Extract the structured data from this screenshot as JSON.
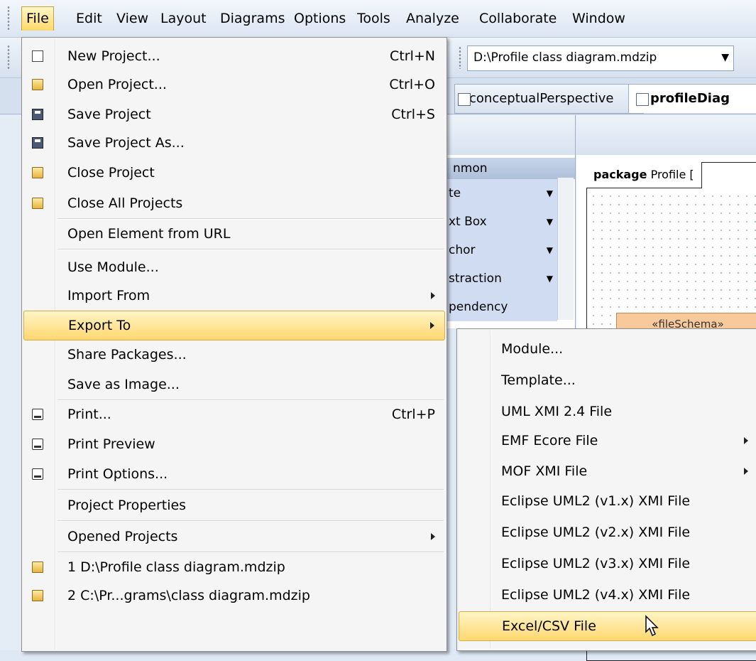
{
  "menubar": {
    "items": [
      "File",
      "Edit",
      "View",
      "Layout",
      "Diagrams",
      "Options",
      "Tools",
      "Analyze",
      "Collaborate",
      "Window"
    ]
  },
  "toolbar": {
    "project_combo": "D:\\Profile class diagram.mdzip"
  },
  "tabs": {
    "tab1": "conceptualPerspective",
    "tab2": "profileDiag"
  },
  "palette": {
    "header": "nmon",
    "rows": [
      "te",
      "xt Box",
      "chor",
      "straction",
      "pendency"
    ]
  },
  "diagram": {
    "package_label": "package  Profile [",
    "schema": "«fileSchema»"
  },
  "file_menu": {
    "items": [
      {
        "label": "New Project...",
        "shortcut": "Ctrl+N",
        "icon": "new-document-icon"
      },
      {
        "label": "Open Project...",
        "shortcut": "Ctrl+O",
        "icon": "open-folder-icon"
      },
      {
        "label": "Save Project",
        "shortcut": "Ctrl+S",
        "icon": "save-icon"
      },
      {
        "label": "Save Project As...",
        "shortcut": "",
        "icon": "save-as-icon"
      },
      {
        "label": "Close Project",
        "shortcut": "",
        "icon": "close-folder-icon"
      },
      {
        "label": "Close All Projects",
        "shortcut": "",
        "icon": "close-all-folders-icon"
      },
      {
        "label": "Open Element from URL",
        "shortcut": ""
      },
      {
        "label": "Use Module...",
        "shortcut": ""
      },
      {
        "label": "Import From",
        "shortcut": "",
        "submenu": true
      },
      {
        "label": "Export To",
        "shortcut": "",
        "submenu": true,
        "highlighted": true
      },
      {
        "label": "Share Packages...",
        "shortcut": ""
      },
      {
        "label": "Save as Image...",
        "shortcut": ""
      },
      {
        "label": "Print...",
        "shortcut": "Ctrl+P",
        "icon": "print-icon"
      },
      {
        "label": "Print Preview",
        "shortcut": "",
        "icon": "print-preview-icon"
      },
      {
        "label": "Print Options...",
        "shortcut": "",
        "icon": "print-options-icon"
      },
      {
        "label": "Project Properties",
        "shortcut": ""
      },
      {
        "label": "Opened Projects",
        "shortcut": "",
        "submenu": true
      },
      {
        "label": "1 D:\\Profile class diagram.mdzip",
        "shortcut": "",
        "icon": "recent-project-icon"
      },
      {
        "label": "2 C:\\Pr...grams\\class diagram.mdzip",
        "shortcut": "",
        "icon": "recent-project-icon"
      }
    ]
  },
  "export_menu": {
    "items": [
      {
        "label": "Module..."
      },
      {
        "label": "Template..."
      },
      {
        "label": "UML XMI 2.4 File"
      },
      {
        "label": "EMF Ecore File",
        "submenu": true
      },
      {
        "label": "MOF XMI File",
        "submenu": true
      },
      {
        "label": "Eclipse UML2 (v1.x) XMI File"
      },
      {
        "label": "Eclipse UML2 (v2.x) XMI File"
      },
      {
        "label": "Eclipse UML2 (v3.x) XMI File"
      },
      {
        "label": "Eclipse UML2 (v4.x) XMI File"
      },
      {
        "label": "Excel/CSV File",
        "highlighted": true
      }
    ]
  }
}
